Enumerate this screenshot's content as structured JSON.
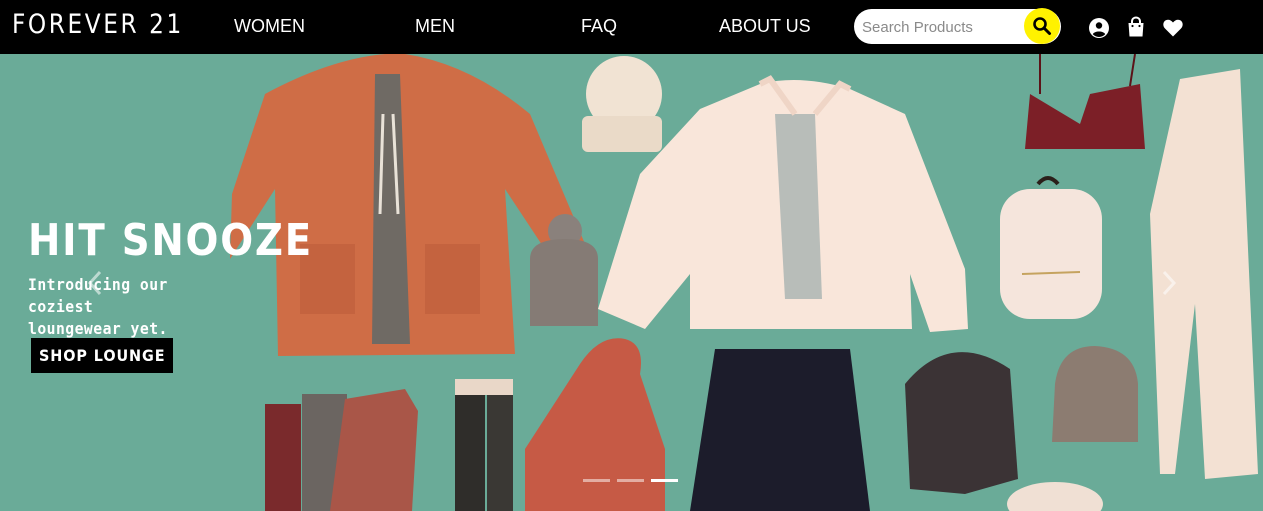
{
  "brand": {
    "logo_text": "FOREVER 21"
  },
  "nav": {
    "links": [
      {
        "label": "WOMEN"
      },
      {
        "label": "MEN"
      },
      {
        "label": "FAQ"
      },
      {
        "label": "ABOUT US"
      }
    ]
  },
  "search": {
    "placeholder": "Search Products",
    "value": "",
    "button_color": "#fff200"
  },
  "header_icons": [
    "user-account-icon",
    "shopping-bag-icon",
    "wishlist-heart-icon"
  ],
  "hero": {
    "headline": "HIT SNOOZE",
    "subline_1": "Introducing our coziest",
    "subline_2": "loungewear yet.",
    "cta_label": "SHOP LOUNGE",
    "background_color": "#6aab98",
    "carousel": {
      "slide_count": 3,
      "active_index": 2
    }
  },
  "colors": {
    "navbar": "#000000",
    "accent": "#fff200",
    "text_light": "#ffffff"
  }
}
